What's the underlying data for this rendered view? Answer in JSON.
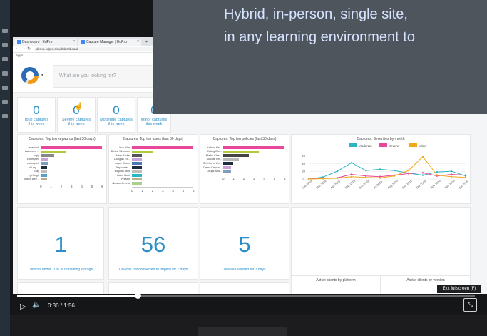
{
  "overlay": {
    "line1": "Hybrid, in-person, single site,",
    "line2": "in any learning environment to"
  },
  "browser": {
    "tabs": [
      {
        "label": "Dashboard | EdPro"
      },
      {
        "label": "Capture Manager | EdPro"
      }
    ],
    "new_tab": "+",
    "url": "demo.edpro.cloud/dashboard",
    "bookmarks": "Apps"
  },
  "app": {
    "search_placeholder": "What are you looking for?",
    "colors": {
      "accent": "#2b8ec9",
      "logo_blue": "#2d6cb3",
      "logo_orange": "#f19a1a"
    }
  },
  "stats": [
    {
      "value": "0",
      "label": "Total captures",
      "sub": "this week"
    },
    {
      "value": "0",
      "label": "Severe captures",
      "sub": "this week"
    },
    {
      "value": "0",
      "label": "Moderate captures",
      "sub": "this week"
    },
    {
      "value": "0",
      "label": "Minor captures",
      "sub": "this week"
    }
  ],
  "charts": {
    "keywords": {
      "title": "Captures: Top ten keywords (last 30 days)",
      "labels": [
        "facebook",
        "bathroom ...",
        "ugly",
        "cut myself",
        "cut myself",
        "kill my ...",
        "Gay",
        "get high",
        "cotton wee..."
      ],
      "ticks": [
        "0",
        "1",
        "2",
        "3",
        "4",
        "5",
        "6"
      ]
    },
    "users": {
      "title": "Captures: Top ten users (last 30 days)",
      "labels": [
        "Ivor Allan",
        "Debra Simmons",
        "Peter Parker",
        "Douglas Ro...",
        "Joyce Brown",
        "Stephanie ...",
        "Bogdan Jane",
        "Kiara Hicks",
        "Preston",
        "Nelson Greene"
      ],
      "ticks": [
        "0",
        "1",
        "2",
        "3",
        "4",
        "5",
        "6"
      ]
    },
    "policies": {
      "title": "Captures: Top ten policies (last 30 days)",
      "labels": [
        "school bls...",
        "Eating Dis...",
        "Maths Clas...",
        "Suicide Un...",
        "Self-Harm Un...",
        "Demo Keywo...",
        "Drugs and..."
      ],
      "ticks": [
        "0",
        "1",
        "2",
        "3",
        "4",
        "5",
        "6"
      ]
    },
    "severities": {
      "title": "Captures: Severities by month",
      "legend": [
        "Moderate",
        "Severe",
        "Minor"
      ],
      "yticks": [
        "60",
        "40",
        "20",
        "0"
      ],
      "xticks": [
        "Feb 2019",
        "Mar 2019",
        "Apr 2019",
        "May 2019",
        "Jun 2019",
        "Jul 2019",
        "Aug 2019",
        "Sep 2019",
        "Oct 2019",
        "Nov 2019",
        "Dec 2019",
        "Jan 2020"
      ]
    }
  },
  "chart_data": [
    {
      "type": "bar",
      "title": "Captures: Top ten keywords (last 30 days)",
      "categories": [
        "facebook",
        "bathroom ...",
        "ugly",
        "cut myself",
        "cut myself",
        "kill my ...",
        "Gay",
        "get high",
        "cotton wee..."
      ],
      "values": [
        6,
        2.5,
        1.3,
        0.8,
        0.8,
        0.6,
        0.6,
        0.6,
        0.6
      ],
      "colors": [
        "#e8479a",
        "#b2c93a",
        "#888888",
        "#c9a2d8",
        "#7f9dbf",
        "#1f2f3f",
        "#bebebe",
        "#5aa0c8",
        "#b8b08a"
      ],
      "xlim": [
        0,
        6
      ]
    },
    {
      "type": "bar",
      "title": "Captures: Top ten users (last 30 days)",
      "categories": [
        "Ivor Allan",
        "Debra Simmons",
        "Peter Parker",
        "Douglas Ro...",
        "Joyce Brown",
        "Stephanie ...",
        "Bogdan Jane",
        "Kiara Hicks",
        "Preston",
        "Nelson Greene"
      ],
      "values": [
        6,
        2,
        1,
        1,
        1,
        1,
        1,
        1,
        1,
        1
      ],
      "colors": [
        "#e8479a",
        "#b2c93a",
        "#555555",
        "#c9a2d8",
        "#4a7ab8",
        "#1f2f3f",
        "#bebebe",
        "#2bb6c8",
        "#b8b08a",
        "#a8d08d"
      ],
      "xlim": [
        0,
        6
      ]
    },
    {
      "type": "bar",
      "title": "Captures: Top ten policies (last 30 days)",
      "categories": [
        "school bls...",
        "Eating Dis...",
        "Maths Clas...",
        "Suicide Un...",
        "Self-Harm Un...",
        "Demo Keywo...",
        "Drugs and..."
      ],
      "values": [
        6,
        3.5,
        2.5,
        1.5,
        1.0,
        0.8,
        0.8
      ],
      "colors": [
        "#e8479a",
        "#b2c93a",
        "#444444",
        "#b8b8b8",
        "#1f2f3f",
        "#c9a2d8",
        "#7f9dbf"
      ],
      "xlim": [
        0,
        6
      ]
    },
    {
      "type": "line",
      "title": "Captures: Severities by month",
      "x": [
        "Feb 2019",
        "Mar 2019",
        "Apr 2019",
        "May 2019",
        "Jun 2019",
        "Jul 2019",
        "Aug 2019",
        "Sep 2019",
        "Oct 2019",
        "Nov 2019",
        "Dec 2019",
        "Jan 2020"
      ],
      "ylim": [
        0,
        70
      ],
      "series": [
        {
          "name": "Moderate",
          "color": "#2bb6c8",
          "values": [
            0,
            5,
            20,
            42,
            22,
            25,
            22,
            15,
            10,
            18,
            20,
            8
          ]
        },
        {
          "name": "Severe",
          "color": "#e8479a",
          "values": [
            0,
            2,
            3,
            12,
            8,
            6,
            10,
            14,
            16,
            8,
            12,
            10
          ]
        },
        {
          "name": "Minor",
          "color": "#f1a81c",
          "values": [
            0,
            1,
            2,
            6,
            4,
            3,
            8,
            22,
            58,
            10,
            6,
            4
          ]
        }
      ]
    }
  ],
  "big_stats": [
    {
      "value": "1",
      "label": "Devices under 10% of remaining storage"
    },
    {
      "value": "56",
      "label": "Devices not connected to Impero for 7 days"
    },
    {
      "value": "5",
      "label": "Devices unused for 7 days"
    }
  ],
  "bottom_cards": {
    "platform_title": "Active clients by platform",
    "version_title": "Active clients by version"
  },
  "player": {
    "current_time": "0:30",
    "separator": "/",
    "duration": "1:56",
    "progress_fraction": 0.264,
    "tooltip": "Exit fullscreen (F)",
    "play_icon": "play-icon",
    "volume_icon": "volume-icon",
    "fullscreen_icon": "exit-fullscreen-icon"
  }
}
